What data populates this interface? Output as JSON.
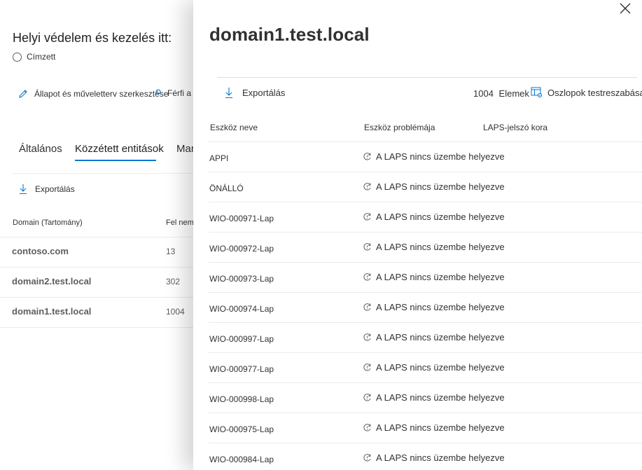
{
  "background": {
    "title": "Helyi védelem és kezelés itt:",
    "radio_label": "Címzett",
    "edit_action": "Állapot és műveletterv szerkesztése",
    "assign_action": "Férfi a",
    "tabs": [
      "Általános",
      "Közzétett entitások",
      "Manó"
    ],
    "export_label": "Exportálás",
    "columns": [
      "Domain (Tartomány)",
      "Fel nem iktatva"
    ],
    "rows": [
      {
        "domain": "contoso.com",
        "count": "13"
      },
      {
        "domain": "domain2.test.local",
        "count": "302"
      },
      {
        "domain": "domain1.test.local",
        "count": "1004"
      }
    ]
  },
  "panel": {
    "title": "domain1.test.local",
    "export_label": "Exportálás",
    "item_count": "1004",
    "item_count_label": "Elemek",
    "customize_columns_label": "Oszlopok testreszabása",
    "columns": {
      "device_name": "Eszköz neve",
      "device_issue": "Eszköz problémája",
      "laps_age": "LAPS-jelszó kora"
    },
    "rows": [
      {
        "device": "APPI",
        "issue": "A LAPS nincs üzembe helyezve"
      },
      {
        "device": "ÖNÁLLÓ",
        "issue": "A LAPS nincs üzembe helyezve"
      },
      {
        "device": "WIO-000971-Lap",
        "issue": "A LAPS nincs üzembe helyezve"
      },
      {
        "device": "WIO-000972-Lap",
        "issue": "A LAPS nincs üzembe helyezve"
      },
      {
        "device": "WIO-000973-Lap",
        "issue": "A LAPS nincs üzembe helyezve"
      },
      {
        "device": "WIO-000974-Lap",
        "issue": "A LAPS nincs üzembe helyezve"
      },
      {
        "device": "WIO-000997-Lap",
        "issue": "A LAPS nincs üzembe helyezve"
      },
      {
        "device": "WIO-000977-Lap",
        "issue": "A LAPS nincs üzembe helyezve"
      },
      {
        "device": "WIO-000998-Lap",
        "issue": "A LAPS nincs üzembe helyezve"
      },
      {
        "device": "WIO-000975-Lap",
        "issue": "A LAPS nincs üzembe helyezve"
      },
      {
        "device": "WIO-000984-Lap",
        "issue": "A LAPS nincs üzembe helyezve"
      }
    ]
  },
  "colors": {
    "accent": "#0078d4",
    "text": "#323130",
    "divider": "#edebe9"
  },
  "icons": {
    "close": "close-icon",
    "download": "download-icon",
    "customize": "customize-columns-icon",
    "edit": "pencil-icon",
    "issue": "sync-warning-icon"
  }
}
